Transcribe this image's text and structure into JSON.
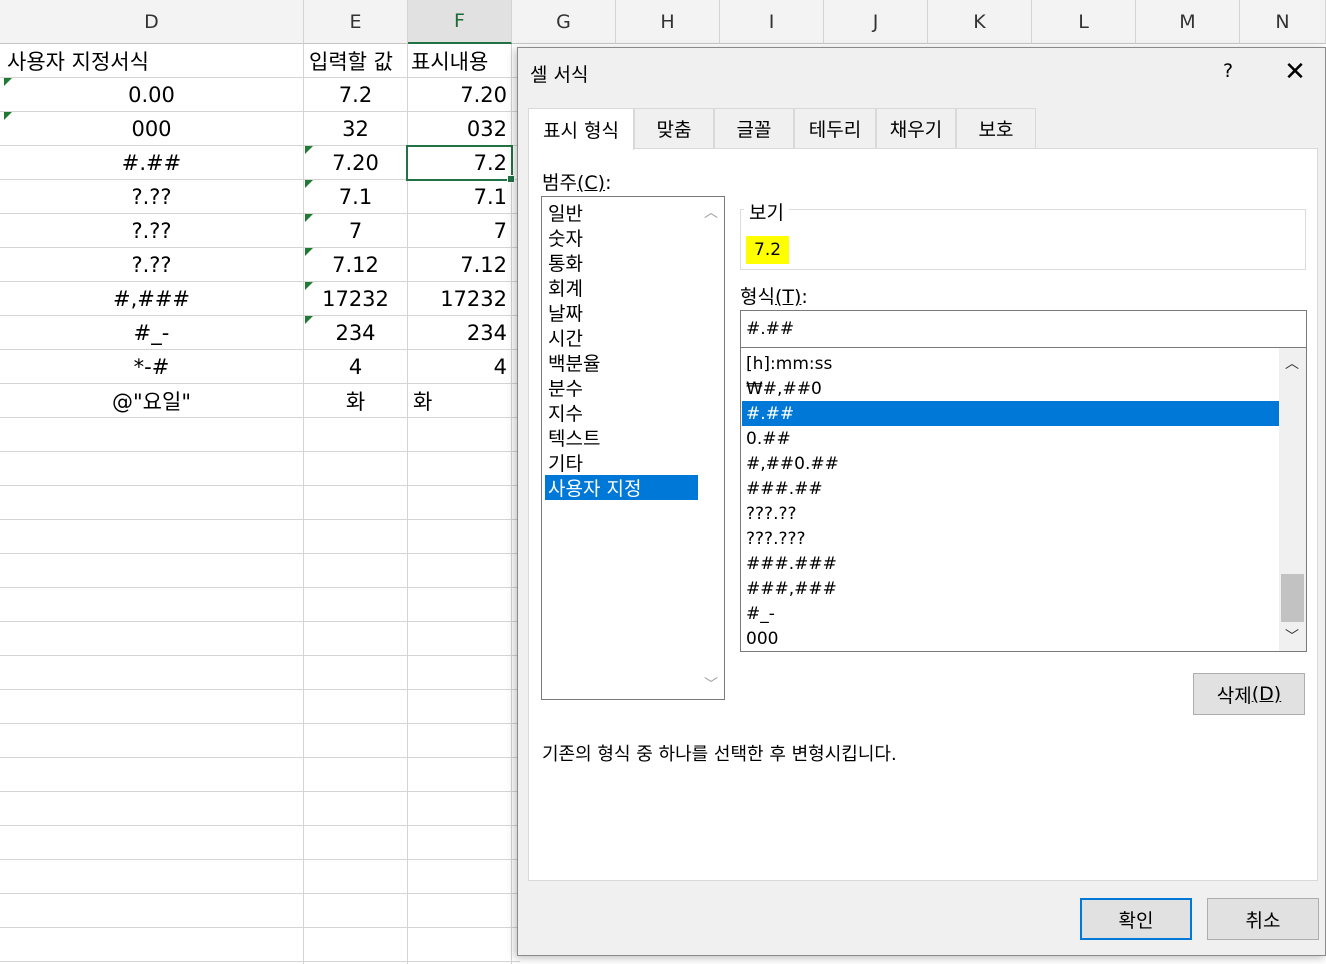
{
  "sheet": {
    "columns": [
      "D",
      "E",
      "F",
      "G",
      "H",
      "I",
      "J",
      "K",
      "L",
      "M",
      "N"
    ],
    "selected_column": "F",
    "headers": {
      "d": "사용자 지정서식",
      "e": "입력할 값",
      "f": "표시내용"
    },
    "rows": [
      {
        "d": "0.00",
        "e": "7.2",
        "f": "7.20"
      },
      {
        "d": "000",
        "e": "32",
        "f": "032"
      },
      {
        "d": "#.##",
        "e": "7.20",
        "f": "7.2"
      },
      {
        "d": "?.??",
        "e": "7.1",
        "f": "7.1"
      },
      {
        "d": "?.??",
        "e": "7",
        "f": "7"
      },
      {
        "d": "?.??",
        "e": "7.12",
        "f": "7.12"
      },
      {
        "d": "#,###",
        "e": "17232",
        "f": "17232"
      },
      {
        "d": "#_-",
        "e": "234",
        "f": "234"
      },
      {
        "d": "*-#",
        "e": "4",
        "f": "4"
      },
      {
        "d": "@\"요일\"",
        "e": "화",
        "f": "화"
      }
    ],
    "accent_color": "#217346"
  },
  "dialog": {
    "title": "셀 서식",
    "help_label": "?",
    "close_label": "✕",
    "tabs": [
      "표시 형식",
      "맞춤",
      "글꼴",
      "테두리",
      "채우기",
      "보호"
    ],
    "active_tab": "표시 형식",
    "category_label": "범주",
    "category_hotkey": "(C)",
    "category_colon": ":",
    "categories": [
      "일반",
      "숫자",
      "통화",
      "회계",
      "날짜",
      "시간",
      "백분율",
      "분수",
      "지수",
      "텍스트",
      "기타",
      "사용자 지정"
    ],
    "selected_category": "사용자 지정",
    "preview_label": "보기",
    "preview_value": "7.2",
    "format_label": "형식",
    "format_hotkey": "(T)",
    "format_colon": ":",
    "format_input_value": "#.##",
    "formats": [
      "[h]:mm:ss",
      "₩#,##0",
      "#.##",
      "0.##",
      "#,##0.##",
      "###.##",
      "???.??",
      "???.???",
      "###.###",
      "###,###",
      "#_-",
      "000"
    ],
    "selected_format": "#.##",
    "delete_label": "삭제",
    "delete_hotkey": "(D)",
    "description": "기존의 형식 중 하나를 선택한 후 변형시킵니다.",
    "ok_label": "확인",
    "cancel_label": "취소",
    "selection_color": "#0078d7",
    "preview_highlight": "#ffff00"
  }
}
